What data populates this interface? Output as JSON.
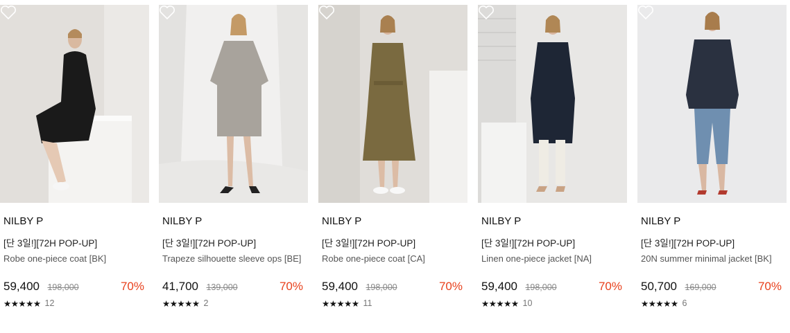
{
  "products": [
    {
      "brand": "NILBY P",
      "tag": "[단 3일!][72H POP-UP]",
      "name": "Robe one-piece coat [BK]",
      "price": "59,400",
      "original_price": "198,000",
      "discount": "70%",
      "stars": "★★★★★",
      "review_count": "12",
      "image_desc": "model in black robe coat sitting on white box",
      "bg_color": "#e4e1dd",
      "outfit_color": "#1a1a1a"
    },
    {
      "brand": "NILBY P",
      "tag": "[단 3일!][72H POP-UP]",
      "name": "Trapeze silhouette sleeve ops [BE]",
      "price": "41,700",
      "original_price": "139,000",
      "discount": "70%",
      "stars": "★★★★★",
      "review_count": "2",
      "image_desc": "model in beige trapeze dress against white drape",
      "bg_color": "#ecebea",
      "outfit_color": "#a8a39c"
    },
    {
      "brand": "NILBY P",
      "tag": "[단 3일!][72H POP-UP]",
      "name": "Robe one-piece coat [CA]",
      "price": "59,400",
      "original_price": "198,000",
      "discount": "70%",
      "stars": "★★★★★",
      "review_count": "11",
      "image_desc": "model in camel robe coat standing",
      "bg_color": "#e2dfdb",
      "outfit_color": "#7a6a40"
    },
    {
      "brand": "NILBY P",
      "tag": "[단 3일!][72H POP-UP]",
      "name": "Linen one-piece jacket [NA]",
      "price": "59,400",
      "original_price": "198,000",
      "discount": "70%",
      "stars": "★★★★★",
      "review_count": "10",
      "image_desc": "model in navy long jacket with white pants",
      "bg_color": "#e6e5e3",
      "outfit_color": "#1e2635"
    },
    {
      "brand": "NILBY P",
      "tag": "[단 3일!][72H POP-UP]",
      "name": "20N summer minimal jacket [BK]",
      "price": "50,700",
      "original_price": "169,000",
      "discount": "70%",
      "stars": "★★★★★",
      "review_count": "6",
      "image_desc": "model in dark jacket with blue jeans",
      "bg_color": "#e9e9ea",
      "outfit_color": "#2a3140"
    }
  ]
}
